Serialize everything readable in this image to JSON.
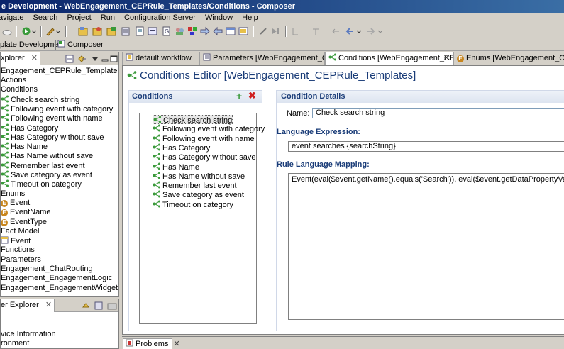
{
  "window": {
    "title": "e Development - WebEngagement_CEPRule_Templates/Conditions - Composer"
  },
  "menu": [
    "avigate",
    "Search",
    "Project",
    "Run",
    "Configuration Server",
    "Window",
    "Help"
  ],
  "perspectives": {
    "left": "plate Development",
    "right": "Composer"
  },
  "explorer": {
    "title": "xplorer",
    "root": "Engagement_CEPRule_Templates",
    "items": [
      {
        "label": "Actions",
        "indent": 0,
        "icon": "none"
      },
      {
        "label": "Conditions",
        "indent": 0,
        "icon": "none"
      },
      {
        "label": "Check search string",
        "indent": 1,
        "icon": "condition"
      },
      {
        "label": "Following event with category",
        "indent": 1,
        "icon": "condition"
      },
      {
        "label": "Following event with name",
        "indent": 1,
        "icon": "condition"
      },
      {
        "label": "Has Category",
        "indent": 1,
        "icon": "condition"
      },
      {
        "label": "Has Category without save",
        "indent": 1,
        "icon": "condition"
      },
      {
        "label": "Has Name",
        "indent": 1,
        "icon": "condition"
      },
      {
        "label": "Has Name without save",
        "indent": 1,
        "icon": "condition"
      },
      {
        "label": "Remember last event",
        "indent": 1,
        "icon": "condition"
      },
      {
        "label": "Save category as event",
        "indent": 1,
        "icon": "condition"
      },
      {
        "label": "Timeout on category",
        "indent": 1,
        "icon": "condition"
      },
      {
        "label": "Enums",
        "indent": 0,
        "icon": "none"
      },
      {
        "label": "Event",
        "indent": 1,
        "icon": "enum"
      },
      {
        "label": "EventName",
        "indent": 1,
        "icon": "enum"
      },
      {
        "label": "EventType",
        "indent": 1,
        "icon": "enum"
      },
      {
        "label": "Fact Model",
        "indent": 0,
        "icon": "none"
      },
      {
        "label": "Event",
        "indent": 1,
        "icon": "fact"
      },
      {
        "label": "Functions",
        "indent": 0,
        "icon": "none"
      },
      {
        "label": "Parameters",
        "indent": 0,
        "icon": "none"
      },
      {
        "label": "Engagement_ChatRouting",
        "indent": 0,
        "icon": "none"
      },
      {
        "label": "Engagement_EngagementLogic",
        "indent": 0,
        "icon": "none"
      },
      {
        "label": "Engagement_EngagementWidgets",
        "indent": 0,
        "icon": "none"
      }
    ]
  },
  "server_explorer": {
    "title": "er Explorer",
    "items": [
      "vice Information",
      "ronment"
    ]
  },
  "tabs": [
    {
      "label": "default.workflow",
      "active": false
    },
    {
      "label": "Parameters [WebEngagement_CEPR",
      "active": false
    },
    {
      "label": "Conditions [WebEngagement_CEPR",
      "active": true
    },
    {
      "label": "Enums [WebEngagement_CEPRule_Templates]",
      "active": false
    }
  ],
  "editor": {
    "title": "Conditions Editor [WebEngagement_CEPRule_Templates]",
    "conditions_header": "Conditions",
    "conditions": [
      "Check search string",
      "Following event with category",
      "Following event with name",
      "Has Category",
      "Has Category without save",
      "Has Name",
      "Has Name without save",
      "Remember last event",
      "Save category as event",
      "Timeout on category"
    ],
    "details_header": "Condition Details",
    "name_label": "Name:",
    "name_value": "Check search string",
    "lang_expr_label": "Language Expression:",
    "lang_expr_value": "event searches {searchString}",
    "mapping_label": "Rule Language Mapping:",
    "mapping_value": "Event(eval($event.getName().equals('Search')), eval($event.getDataPropertyValue('searchString').eq"
  },
  "bottom": {
    "problems_label": "Problems"
  }
}
